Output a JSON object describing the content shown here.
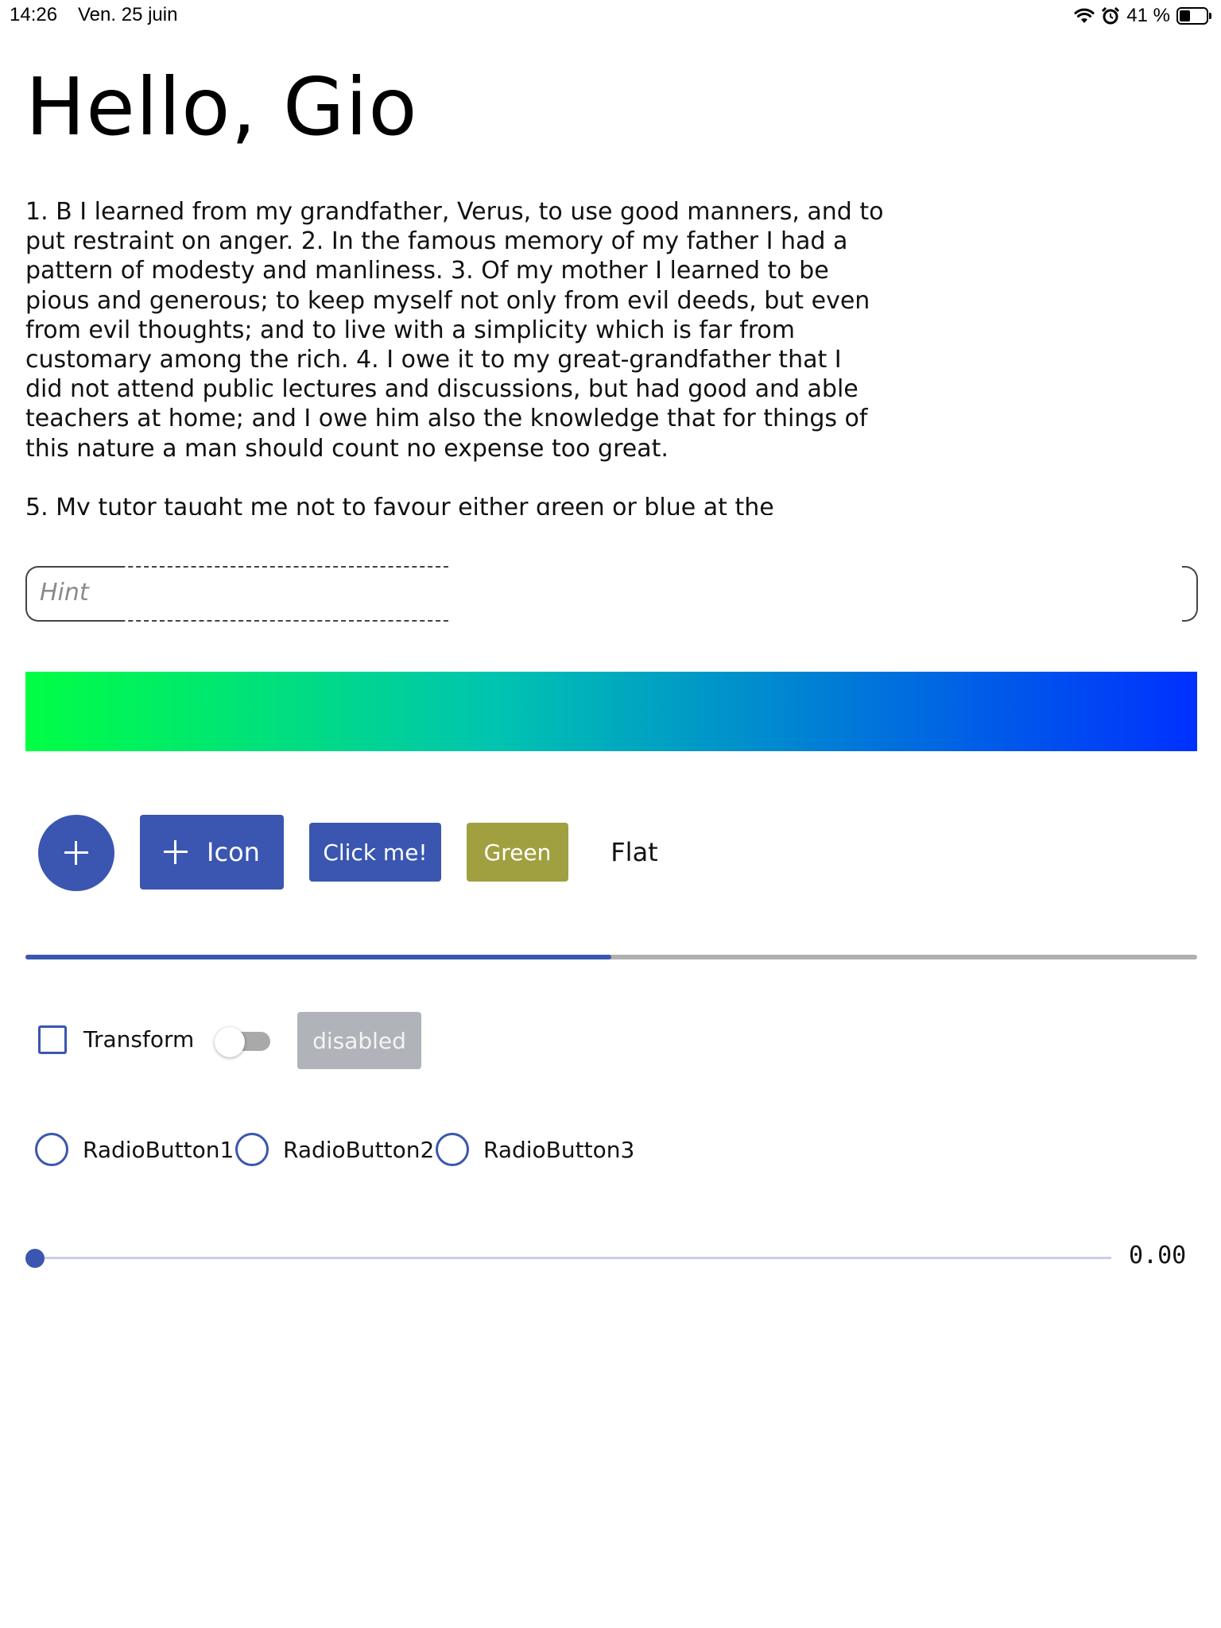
{
  "status_bar": {
    "time": "14:26",
    "date": "Ven. 25 juin",
    "battery_text": "41 %",
    "battery_level": 0.41,
    "icons": [
      "wifi-icon",
      "alarm-icon",
      "battery-icon"
    ]
  },
  "title": "Hello, Gio",
  "editor": {
    "paragraph1": "1. B I learned from my grandfather, Verus, to use good manners, and to put restraint on anger. 2. In the famous memory of my father I had a pattern of modesty and manliness. 3. Of my mother I learned to be pious and generous; to keep myself not only from evil deeds, but even from evil thoughts; and to live with a simplicity which is far from customary among the rich. 4. I owe it to my great-grandfather that I did not attend public lectures and discussions, but had good and able teachers at home; and I owe him also the knowledge that for things of this nature a man should count no expense too great.",
    "paragraph2": "5. My tutor taught me not to favour either green or blue at the"
  },
  "hint_field": {
    "placeholder": "Hint",
    "value": ""
  },
  "gradient": {
    "colors": [
      "#00ff44",
      "#00c4b0",
      "#0030ff"
    ]
  },
  "buttons": {
    "fab_icon": "plus-icon",
    "icon_button_label": "Icon",
    "click_me_label": "Click me!",
    "green_label": "Green",
    "flat_label": "Flat"
  },
  "colors": {
    "primary": "#3a56b0",
    "green_button": "#a0a040",
    "disabled": "#b0b3ba"
  },
  "progress": {
    "value": 0.5
  },
  "controls": {
    "checkbox_label": "Transform",
    "checkbox_checked": false,
    "switch_on": false,
    "disabled_label": "disabled"
  },
  "radios": [
    {
      "label": "RadioButton1"
    },
    {
      "label": "RadioButton2"
    },
    {
      "label": "RadioButton3"
    }
  ],
  "slider": {
    "value": 0.0,
    "value_text": "0.00"
  }
}
